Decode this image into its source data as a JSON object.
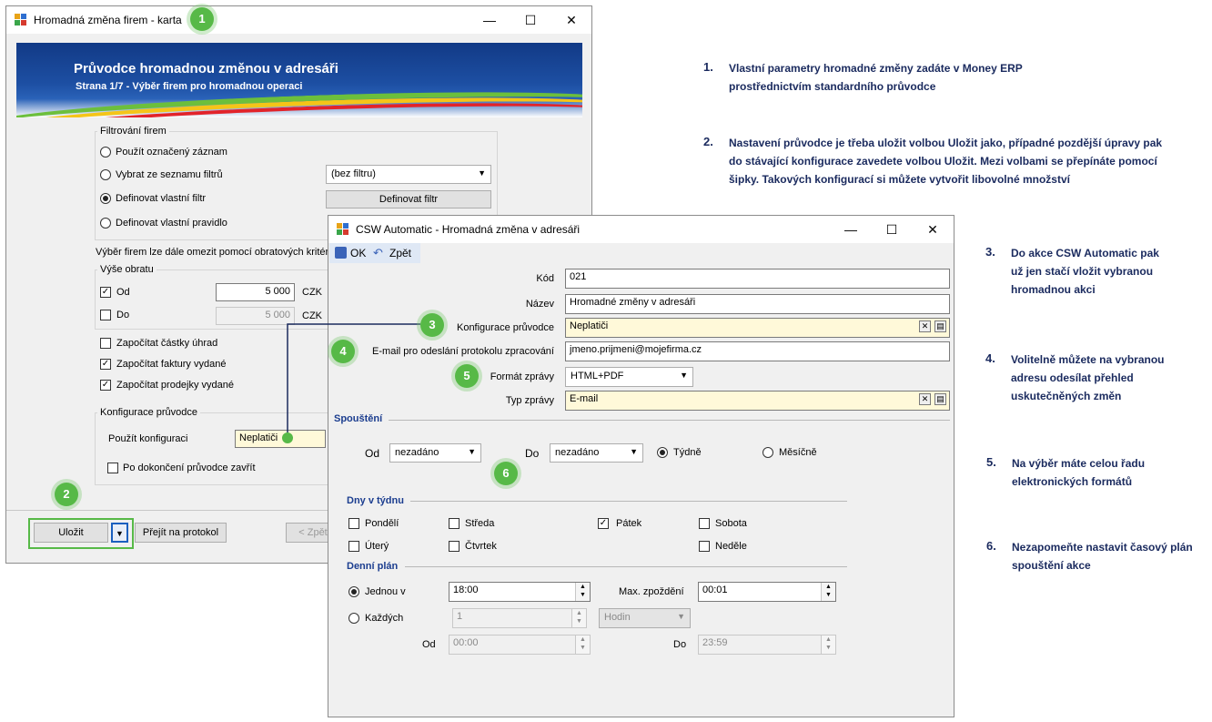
{
  "win1": {
    "title": "Hromadná změna firem - karta",
    "controls": {
      "minimize": "—",
      "maximize": "☐",
      "close": "✕"
    },
    "banner_title": "Průvodce hromadnou změnou v adresáři",
    "banner_subtitle": "Strana 1/7 - Výběr firem pro hromadnou operaci",
    "filter_group": "Filtrování firem",
    "opt_marked": "Použít označený záznam",
    "opt_list": "Vybrat ze seznamu filtrů",
    "opt_define_filter": "Definovat vlastní filtr",
    "opt_define_rule": "Definovat vlastní pravidlo",
    "filter_select": "(bez filtru)",
    "define_filter_button": "Definovat filtr",
    "turnover_note": "Výběr firem lze dále omezit pomocí obratových kritérií",
    "turnover_group": "Výše obratu",
    "from_label": "Od",
    "to_label": "Do",
    "from_value": "5 000",
    "to_value": "5 000",
    "currency": "CZK",
    "chk_payments": "Započítat částky úhrad",
    "chk_invoices": "Započítat faktury vydané",
    "chk_receipts": "Započítat prodejky vydané",
    "config_group": "Konfigurace průvodce",
    "use_config": "Použít konfiguraci",
    "config_value": "Neplatiči",
    "close_after": "Po dokončení průvodce zavřít",
    "save_button": "Uložit",
    "protocol_button": "Přejít na protokol",
    "prev_button": "< Zpět"
  },
  "win2": {
    "title": "CSW Automatic - Hromadná změna v adresáři",
    "controls": {
      "minimize": "—",
      "maximize": "☐",
      "close": "✕"
    },
    "ok": "OK",
    "back": "Zpět",
    "code_label": "Kód",
    "code_value": "021",
    "name_label": "Název",
    "name_value": "Hromadné změny v adresáři",
    "config_label": "Konfigurace průvodce",
    "config_value": "Neplatiči",
    "email_label": "E-mail pro odeslání protokolu zpracování",
    "email_value": "jmeno.prijmeni@mojefirma.cz",
    "format_label": "Formát zprávy",
    "format_value": "HTML+PDF",
    "type_label": "Typ zprávy",
    "type_value": "E-mail",
    "run_section": "Spouštění",
    "from_label": "Od",
    "from_value": "nezadáno",
    "to_label": "Do",
    "to_value": "nezadáno",
    "weekly": "Týdně",
    "monthly": "Měsíčně",
    "days_section": "Dny v týdnu",
    "days": {
      "mon": "Pondělí",
      "wed": "Středa",
      "fri": "Pátek",
      "sat": "Sobota",
      "tue": "Úterý",
      "thu": "Čtvrtek",
      "sun": "Neděle"
    },
    "daily_section": "Denní plán",
    "once_label": "Jednou v",
    "once_value": "18:00",
    "max_delay_label": "Max. zpoždění",
    "max_delay_value": "00:01",
    "every_label": "Každých",
    "every_value": "1",
    "every_unit": "Hodin",
    "range_from_label": "Od",
    "range_from_value": "00:00",
    "range_to_label": "Do",
    "range_to_value": "23:59"
  },
  "badges": [
    "1",
    "2",
    "3",
    "4",
    "5",
    "6"
  ],
  "notes": [
    {
      "num": "1.",
      "text": "Vlastní parametry hromadné změny zadáte v Money ERP prostřednictvím standardního průvodce"
    },
    {
      "num": "2.",
      "text": "Nastavení průvodce je třeba uložit volbou Uložit jako, případné pozdější úpravy pak do stávající konfigurace zavedete volbou Uložit. Mezi volbami se přepínáte pomocí šipky. Takových konfigurací si můžete vytvořit libovolné množství"
    },
    {
      "num": "3.",
      "text": "Do akce CSW Automatic pak už jen stačí vložit vybranou hromadnou akci"
    },
    {
      "num": "4.",
      "text": "Volitelně můžete na vybranou adresu odesílat přehled uskutečněných změn"
    },
    {
      "num": "5.",
      "text": "Na výběr máte celou řadu elektronických formátů"
    },
    {
      "num": "6.",
      "text": "Nezapomeňte nastavit časový plán spouštění akce"
    }
  ],
  "colors": {
    "badge": "#57b947",
    "accent": "#1b3d8f",
    "highlight": "#fff9d9"
  }
}
